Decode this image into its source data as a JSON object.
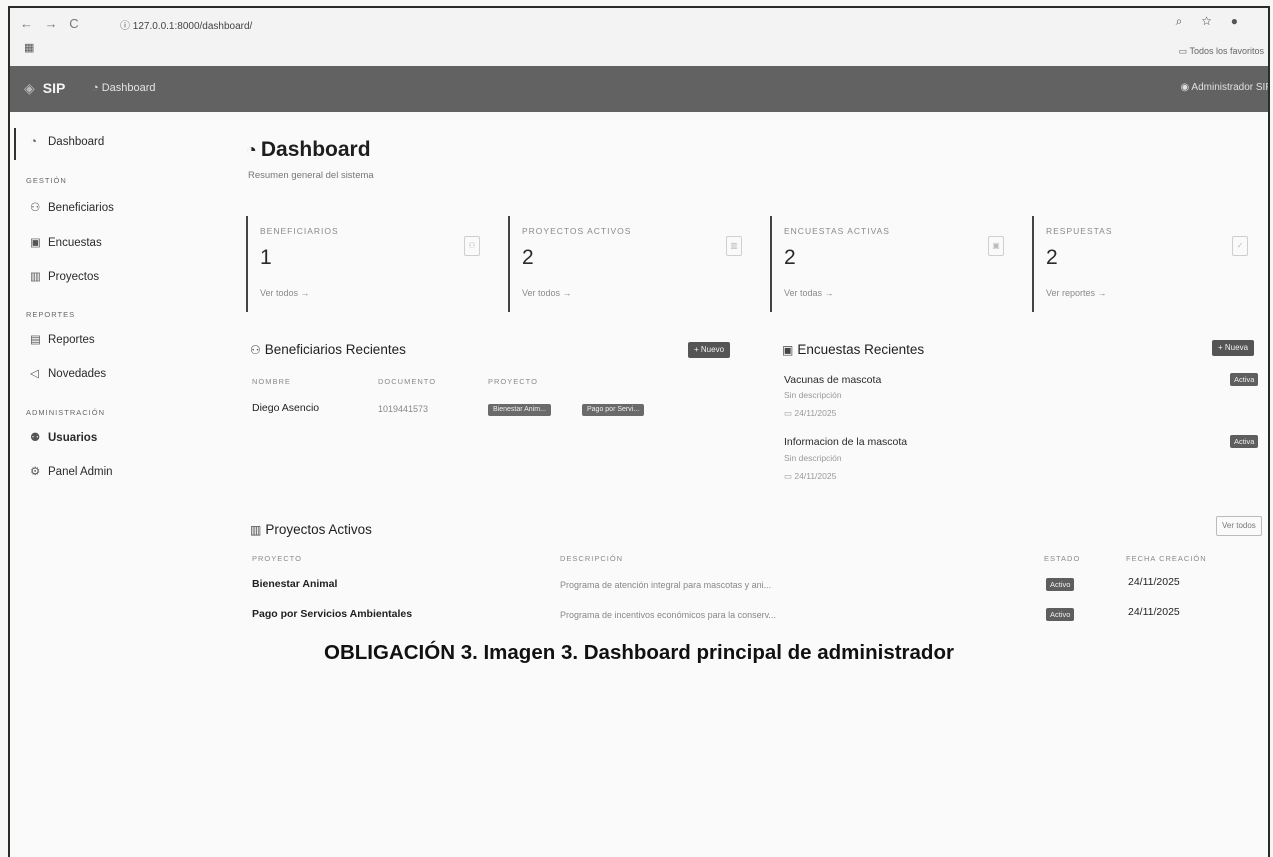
{
  "browser": {
    "nav_icons": "← → C",
    "url": "127.0.0.1:8000/dashboard/",
    "apps_icon": "▦",
    "right_icons": "⌕ ☆ ●",
    "bookmarks": "Todos los favoritos"
  },
  "navbar": {
    "brand": "SIP",
    "breadcrumb": "Dashboard",
    "user": "Administrador SIP"
  },
  "sidebar": {
    "dashboard": "Dashboard",
    "gestion_header": "GESTIÓN",
    "beneficiarios": "Beneficiarios",
    "encuestas": "Encuestas",
    "proyectos": "Proyectos",
    "reportes_header": "REPORTES",
    "reportes": "Reportes",
    "novedades": "Novedades",
    "admin_header": "ADMINISTRACIÓN",
    "usuarios": "Usuarios",
    "panel_admin": "Panel Admin"
  },
  "page": {
    "title": "Dashboard",
    "subtitle": "Resumen general del sistema"
  },
  "stats": [
    {
      "label": "BENEFICIARIOS",
      "value": "1",
      "link": "Ver todos →"
    },
    {
      "label": "PROYECTOS ACTIVOS",
      "value": "2",
      "link": "Ver todos →"
    },
    {
      "label": "ENCUESTAS ACTIVAS",
      "value": "2",
      "link": "Ver todas →"
    },
    {
      "label": "RESPUESTAS",
      "value": "2",
      "link": "Ver reportes →"
    }
  ],
  "beneficiarios_recientes": {
    "title": "Beneficiarios Recientes",
    "new_button": "+ Nuevo",
    "headers": [
      "NOMBRE",
      "DOCUMENTO",
      "PROYECTO"
    ],
    "rows": [
      {
        "nombre": "Diego Asencio",
        "documento": "1019441573",
        "proyectos": [
          "Bienestar Anim...",
          "Pago por Servi..."
        ]
      }
    ]
  },
  "encuestas_recientes": {
    "title": "Encuestas Recientes",
    "new_button": "+ Nueva",
    "items": [
      {
        "title": "Vacunas de mascota",
        "desc": "Sin descripción",
        "date": "24/11/2025",
        "status": "Activa"
      },
      {
        "title": "Informacion de la mascota",
        "desc": "Sin descripción",
        "date": "24/11/2025",
        "status": "Activa"
      }
    ]
  },
  "proyectos_activos": {
    "title": "Proyectos Activos",
    "view_all": "Ver todos",
    "headers": [
      "PROYECTO",
      "DESCRIPCIÓN",
      "ESTADO",
      "FECHA CREACIÓN"
    ],
    "rows": [
      {
        "proyecto": "Bienestar Animal",
        "descripcion": "Programa de atención integral para mascotas y ani...",
        "estado": "Activo",
        "fecha": "24/11/2025"
      },
      {
        "proyecto": "Pago por Servicios Ambientales",
        "descripcion": "Programa de incentivos económicos para la conserv...",
        "estado": "Activo",
        "fecha": "24/11/2025"
      }
    ]
  },
  "caption": "OBLIGACIÓN 3. Imagen 3. Dashboard principal de administrador"
}
